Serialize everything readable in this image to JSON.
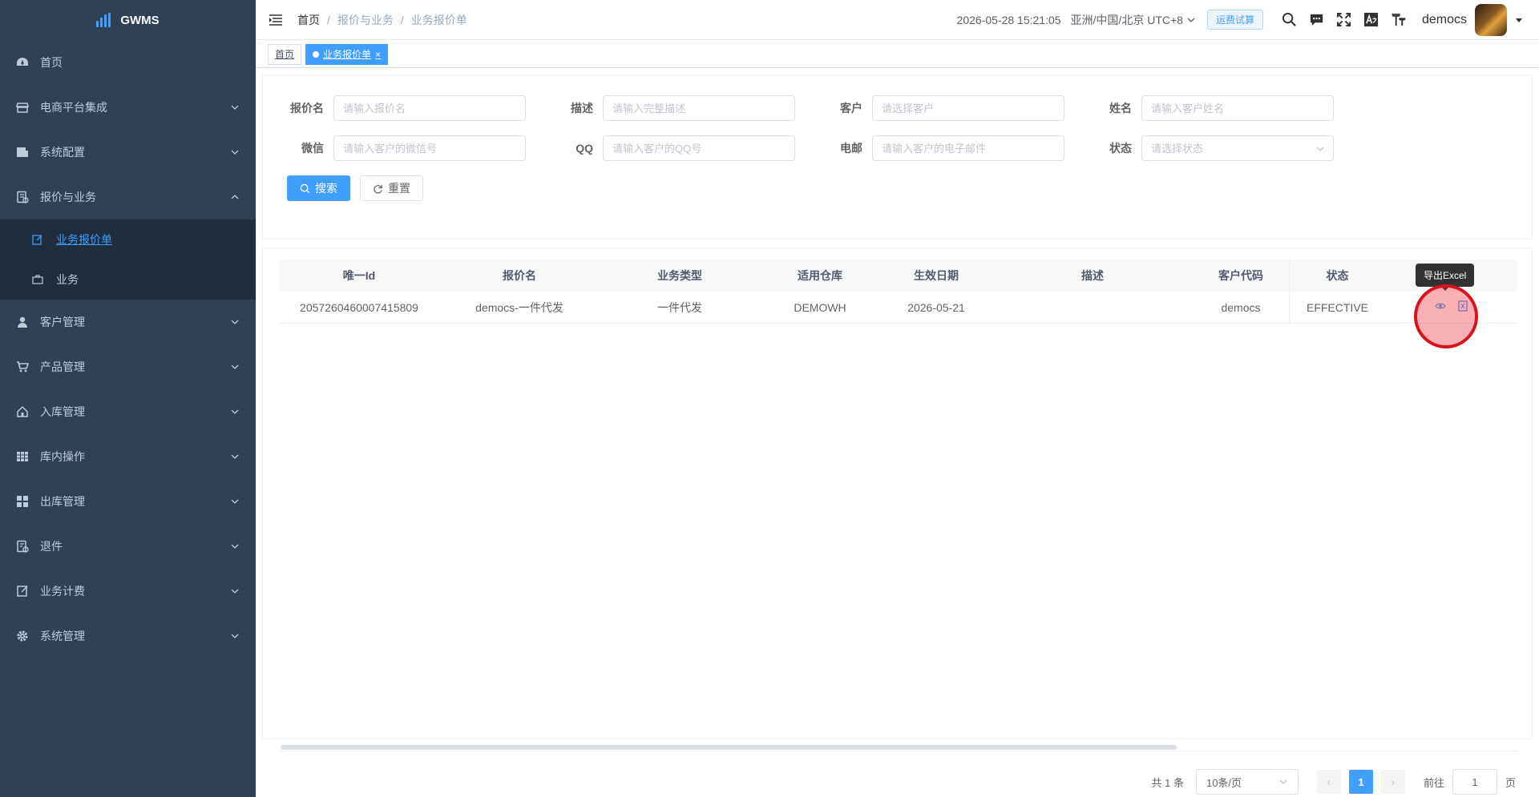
{
  "app": {
    "logo_text": "GWMS"
  },
  "sidebar": {
    "items": [
      {
        "label": "首页",
        "icon": "dashboard-icon"
      },
      {
        "label": "电商平台集成",
        "icon": "store-icon"
      },
      {
        "label": "系统配置",
        "icon": "config-icon"
      },
      {
        "label": "报价与业务",
        "icon": "quote-icon",
        "expanded": true
      },
      {
        "label": "客户管理",
        "icon": "user-icon"
      },
      {
        "label": "产品管理",
        "icon": "cart-icon"
      },
      {
        "label": "入库管理",
        "icon": "home-icon"
      },
      {
        "label": "库内操作",
        "icon": "grid-icon"
      },
      {
        "label": "出库管理",
        "icon": "apps-icon"
      },
      {
        "label": "退件",
        "icon": "return-icon"
      },
      {
        "label": "业务计费",
        "icon": "edit-icon"
      },
      {
        "label": "系统管理",
        "icon": "gear-icon"
      }
    ],
    "submenu": [
      {
        "label": "业务报价单",
        "active": true
      },
      {
        "label": "业务",
        "active": false
      }
    ]
  },
  "header": {
    "breadcrumb": [
      "首页",
      "报价与业务",
      "业务报价单"
    ],
    "datetime": "2026-05-28 15:21:05",
    "timezone": "亚洲/中国/北京 UTC+8",
    "freight_button": "运费试算",
    "username": "democs"
  },
  "tags": [
    {
      "label": "首页",
      "active": false
    },
    {
      "label": "业务报价单",
      "active": true,
      "close": "×"
    }
  ],
  "search_form": {
    "fields": [
      {
        "label": "报价名",
        "placeholder": "请输入报价名"
      },
      {
        "label": "描述",
        "placeholder": "请输入完整描述"
      },
      {
        "label": "客户",
        "placeholder": "请选择客户"
      },
      {
        "label": "姓名",
        "placeholder": "请输入客户姓名"
      },
      {
        "label": "微信",
        "placeholder": "请输入客户的微信号"
      },
      {
        "label": "QQ",
        "placeholder": "请输入客户的QQ号"
      },
      {
        "label": "电邮",
        "placeholder": "请输入客户的电子邮件"
      },
      {
        "label": "状态",
        "placeholder": "请选择状态"
      }
    ],
    "search_button": "搜索",
    "reset_button": "重置"
  },
  "table": {
    "columns": [
      "唯一Id",
      "报价名",
      "业务类型",
      "适用仓库",
      "生效日期",
      "描述",
      "客户代码",
      "状态"
    ],
    "rows": [
      [
        "2057260460007415809",
        "democs-一件代发",
        "一件代发",
        "DEMOWH",
        "2026-05-21",
        "",
        "democs",
        "EFFECTIVE"
      ]
    ],
    "tooltip": "导出Excel"
  },
  "pagination": {
    "total": "共 1 条",
    "page_size": "10条/页",
    "current_page": "1",
    "goto_label": "前往",
    "goto_value": "1",
    "page_suffix": "页",
    "prev": "‹",
    "next": "›"
  },
  "colors": {
    "sidebar_bg": "#304156",
    "submenu_bg": "#1f2d3d",
    "accent": "#409eff",
    "click_marker": "#d9101e"
  }
}
